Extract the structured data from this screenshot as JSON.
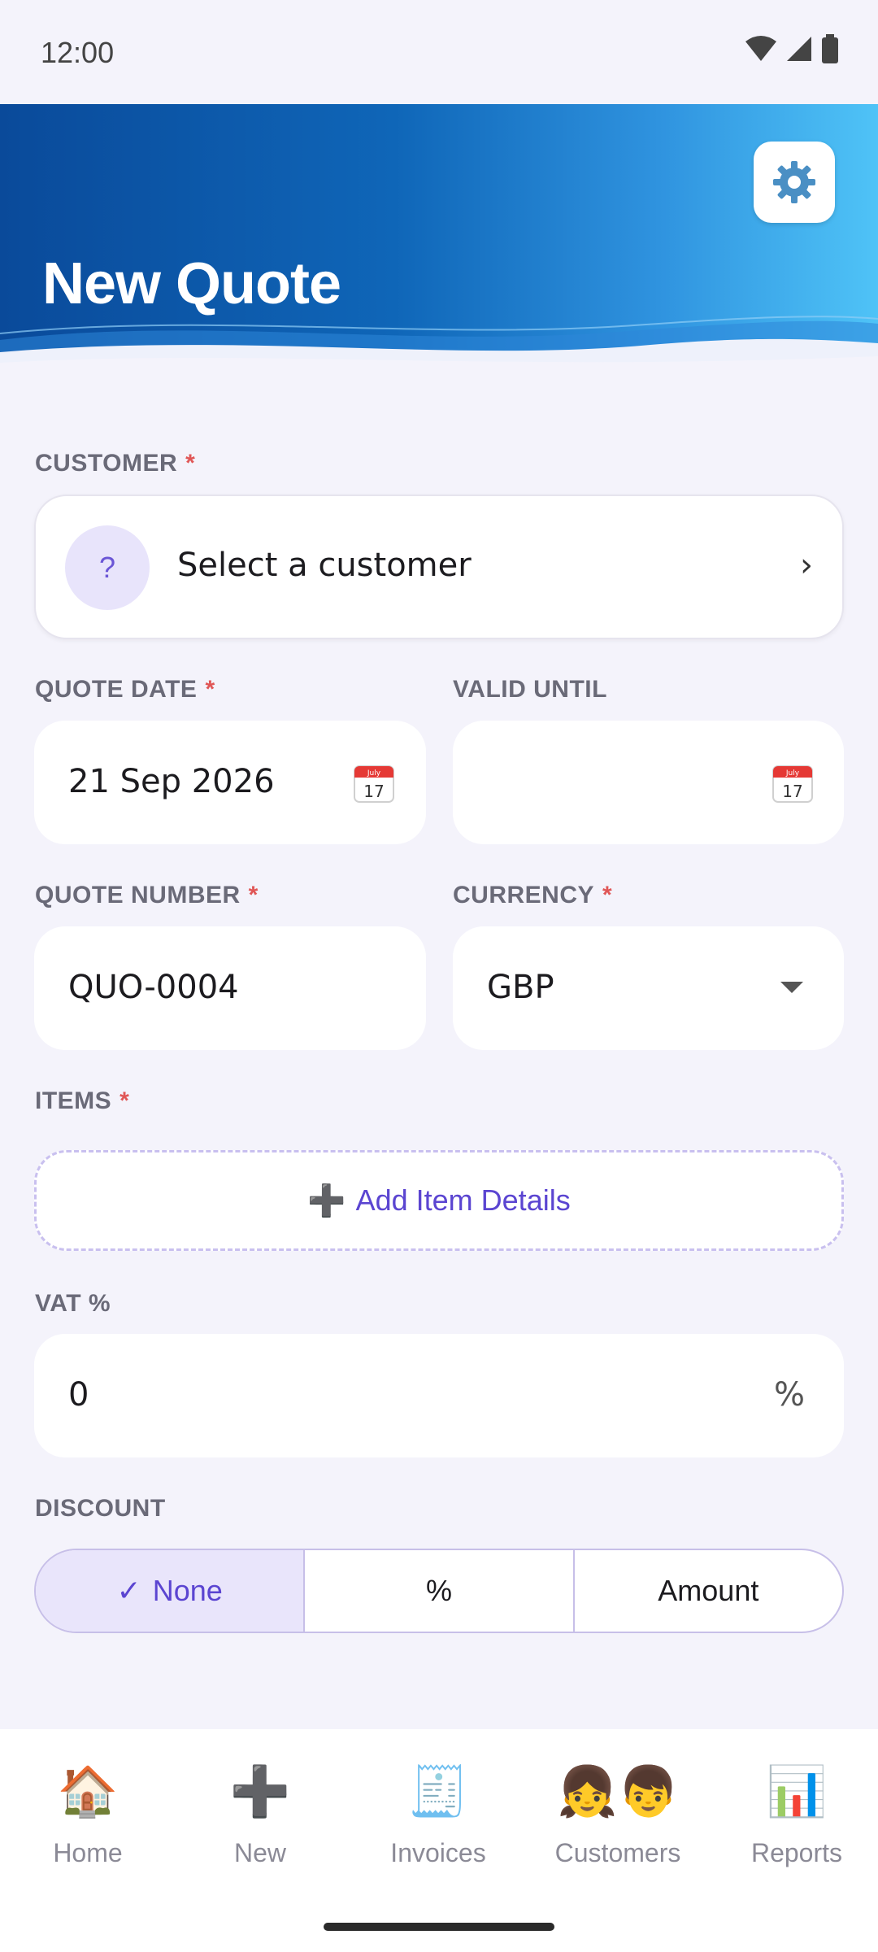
{
  "status_bar": {
    "time": "12:00"
  },
  "header": {
    "title": "New Quote",
    "settings_icon": "gear-icon"
  },
  "customer": {
    "label": "CUSTOMER",
    "required": "*",
    "avatar": "?",
    "placeholder": "Select a customer",
    "chevron": "›"
  },
  "quote_date": {
    "label": "QUOTE DATE",
    "required": "*",
    "value": "21 Sep 2026",
    "calendar_icon_text": "July",
    "calendar_icon_day": "17"
  },
  "valid_until": {
    "label": "VALID UNTIL",
    "value": "",
    "calendar_icon_text": "July",
    "calendar_icon_day": "17"
  },
  "quote_number": {
    "label": "QUOTE NUMBER",
    "required": "*",
    "value": "QUO-0004"
  },
  "currency": {
    "label": "CURRENCY",
    "required": "*",
    "value": "GBP"
  },
  "items": {
    "label": "ITEMS",
    "required": "*",
    "add_label": "Add Item Details",
    "add_icon": "➕"
  },
  "vat": {
    "label": "VAT %",
    "value": "0",
    "suffix": "%"
  },
  "discount": {
    "label": "DISCOUNT",
    "options": [
      {
        "label": "None",
        "selected": true
      },
      {
        "label": "%"
      },
      {
        "label": "Amount"
      }
    ],
    "check": "✓"
  },
  "bottom_nav": {
    "items": [
      {
        "label": "Home",
        "icon": "🏠"
      },
      {
        "label": "New",
        "icon": "➕"
      },
      {
        "label": "Invoices",
        "icon": "🧾"
      },
      {
        "label": "Customers",
        "icon": "👧👦"
      },
      {
        "label": "Reports",
        "icon": "📊"
      }
    ]
  },
  "colors": {
    "accent": "#5b45d1",
    "required": "#e05656",
    "header_start": "#0a4a9a",
    "header_end": "#4fc3f7"
  }
}
